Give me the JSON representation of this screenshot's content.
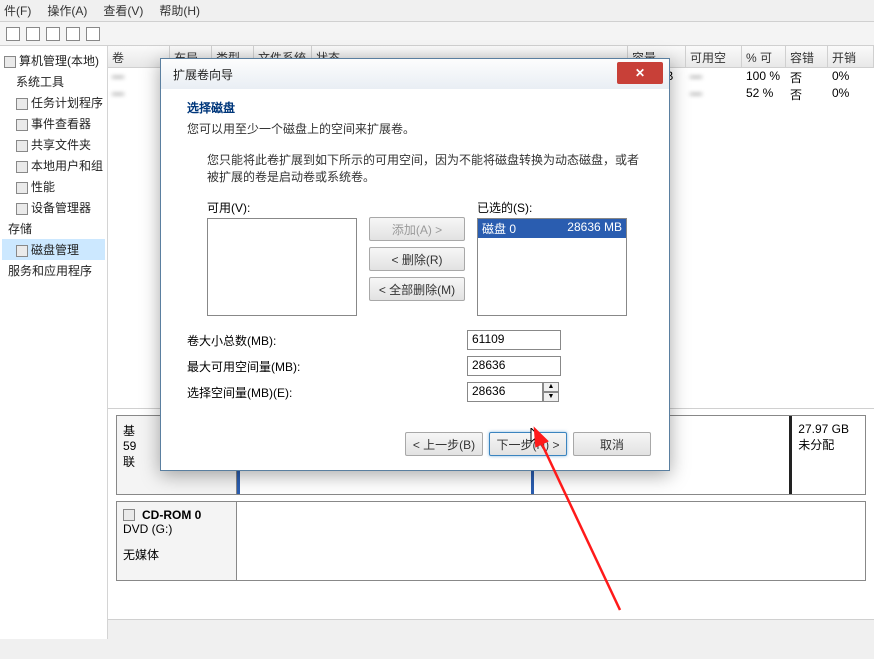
{
  "menubar": {
    "file": "件(F)",
    "action": "操作(A)",
    "view": "查看(V)",
    "help": "帮助(H)"
  },
  "tree": {
    "root": "算机管理(本地)",
    "items": [
      {
        "label": "系统工具"
      },
      {
        "label": "任务计划程序"
      },
      {
        "label": "事件查看器"
      },
      {
        "label": "共享文件夹"
      },
      {
        "label": "本地用户和组"
      },
      {
        "label": "性能"
      },
      {
        "label": "设备管理器"
      },
      {
        "label": "存储"
      },
      {
        "label": "磁盘管理",
        "selected": true
      },
      {
        "label": "服务和应用程序"
      }
    ]
  },
  "list_header": {
    "vol": "卷",
    "layout": "布局",
    "type": "类型",
    "fs": "文件系统",
    "status": "状态",
    "capacity": "容量",
    "free": "可用空间",
    "pct": "% 可用",
    "tolerance": "容错",
    "overhead": "开销"
  },
  "list_rows": [
    {
      "capacity_tail": "B",
      "pct": "100 %",
      "tol": "否",
      "ovr": "0%"
    },
    {
      "capacity_tail": "GB",
      "pct": "52 %",
      "tol": "否",
      "ovr": "0%"
    }
  ],
  "disk0": {
    "label_line1": "基",
    "label_line2": "59",
    "label_line3": "联"
  },
  "unalloc": {
    "size": "27.97 GB",
    "label": "未分配"
  },
  "cdrom": {
    "title": "CD-ROM 0",
    "drive": "DVD (G:)",
    "status": "无媒体"
  },
  "dialog": {
    "title": "扩展卷向导",
    "h1": "选择磁盘",
    "sub": "您可以用至少一个磁盘上的空间来扩展卷。",
    "note": "您只能将此卷扩展到如下所示的可用空间，因为不能将磁盘转换为动态磁盘，或者被扩展的卷是启动卷或系统卷。",
    "available_label": "可用(V):",
    "selected_label": "已选的(S):",
    "selected_item_name": "磁盘 0",
    "selected_item_size": "28636 MB",
    "btn_add": "添加(A) >",
    "btn_remove": "< 删除(R)",
    "btn_remove_all": "< 全部删除(M)",
    "total_label": "卷大小总数(MB):",
    "total_val": "61109",
    "max_label": "最大可用空间量(MB):",
    "max_val": "28636",
    "sel_label": "选择空间量(MB)(E):",
    "sel_val": "28636",
    "back": "< 上一步(B)",
    "next": "下一步(N) >",
    "cancel": "取消"
  }
}
